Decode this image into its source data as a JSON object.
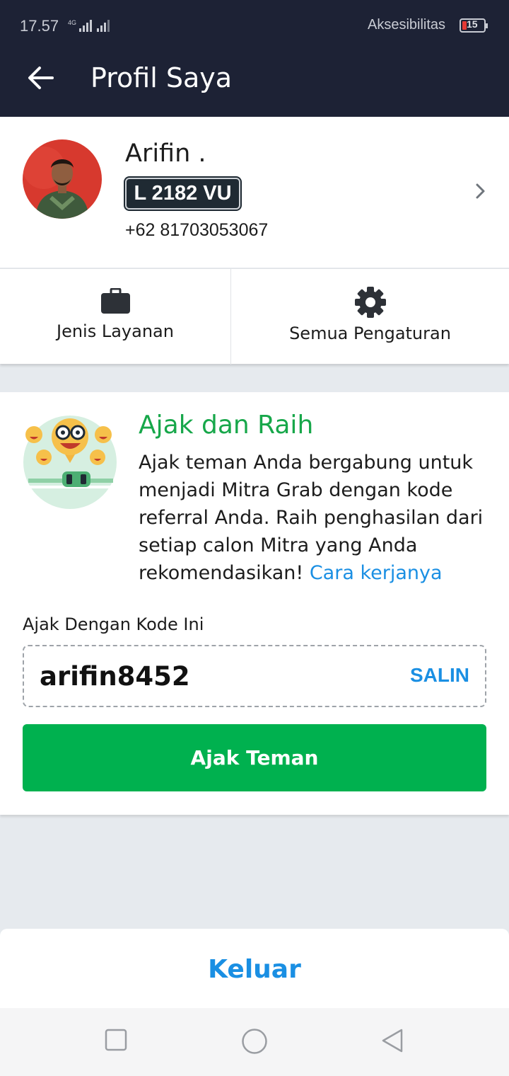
{
  "status_bar": {
    "time": "17.57",
    "network": "4G",
    "accessibility_label": "Aksesibilitas",
    "battery": "15",
    "battery_color": "#e53935"
  },
  "app_bar": {
    "back_icon": "arrow-left-icon",
    "title": "Profil Saya",
    "background": "#1d2235"
  },
  "profile": {
    "name": "Arifin .",
    "plate": "L 2182 VU",
    "phone": "+62 81703053067",
    "chevron_icon": "chevron-right-icon"
  },
  "shortcuts": [
    {
      "icon": "briefcase-icon",
      "label": "Jenis Layanan"
    },
    {
      "icon": "gear-icon",
      "label": "Semua Pengaturan"
    }
  ],
  "referral": {
    "title": "Ajak dan Raih",
    "title_color": "#17a74a",
    "body": "Ajak teman Anda bergabung untuk menjadi Mitra Grab dengan kode referral Anda. Raih penghasilan dari setiap calon Mitra yang Anda rekomendasikan!",
    "link": "Cara kerjanya",
    "link_color": "#1a8fe3",
    "code_label": "Ajak Dengan Kode Ini",
    "code": "arifin8452",
    "copy_label": "SALIN",
    "invite_button": "Ajak Teman",
    "button_color": "#00b14f"
  },
  "logout": {
    "label": "Keluar"
  },
  "nav_bar": {
    "recent_icon": "square-recent-apps-icon",
    "home_icon": "circle-home-icon",
    "back_icon": "triangle-back-icon"
  }
}
